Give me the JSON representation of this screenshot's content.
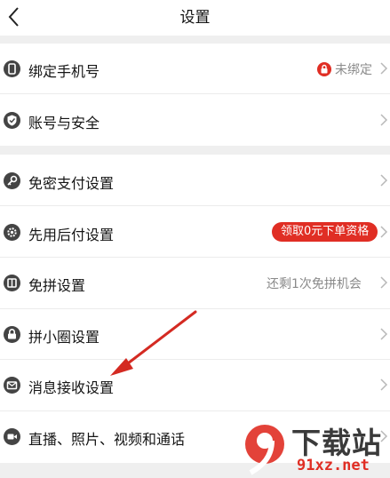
{
  "header": {
    "title": "设置"
  },
  "rows": [
    {
      "label": "绑定手机号",
      "icon": "phone-icon",
      "right_text": "未绑定",
      "right_icon": "lock-icon"
    },
    {
      "label": "账号与安全",
      "icon": "shield-icon"
    },
    {
      "label": "免密支付设置",
      "icon": "key-icon"
    },
    {
      "label": "先用后付设置",
      "icon": "gear-icon",
      "badge": "领取0元下单资格"
    },
    {
      "label": "免拼设置",
      "icon": "ticket-icon",
      "right_text": "还剩1次免拼机会"
    },
    {
      "label": "拼小圈设置",
      "icon": "lock-icon"
    },
    {
      "label": "消息接收设置",
      "icon": "mail-icon"
    },
    {
      "label": "直播、照片、视频和通话",
      "icon": "video-icon"
    }
  ],
  "watermark": {
    "top_text": "下载站",
    "bottom_text": "91xz.net",
    "logo_text": "9"
  },
  "colors": {
    "accent": "#e02e24",
    "gap": "#efefef",
    "icon": "#444444",
    "arrow": "#d42a22"
  }
}
